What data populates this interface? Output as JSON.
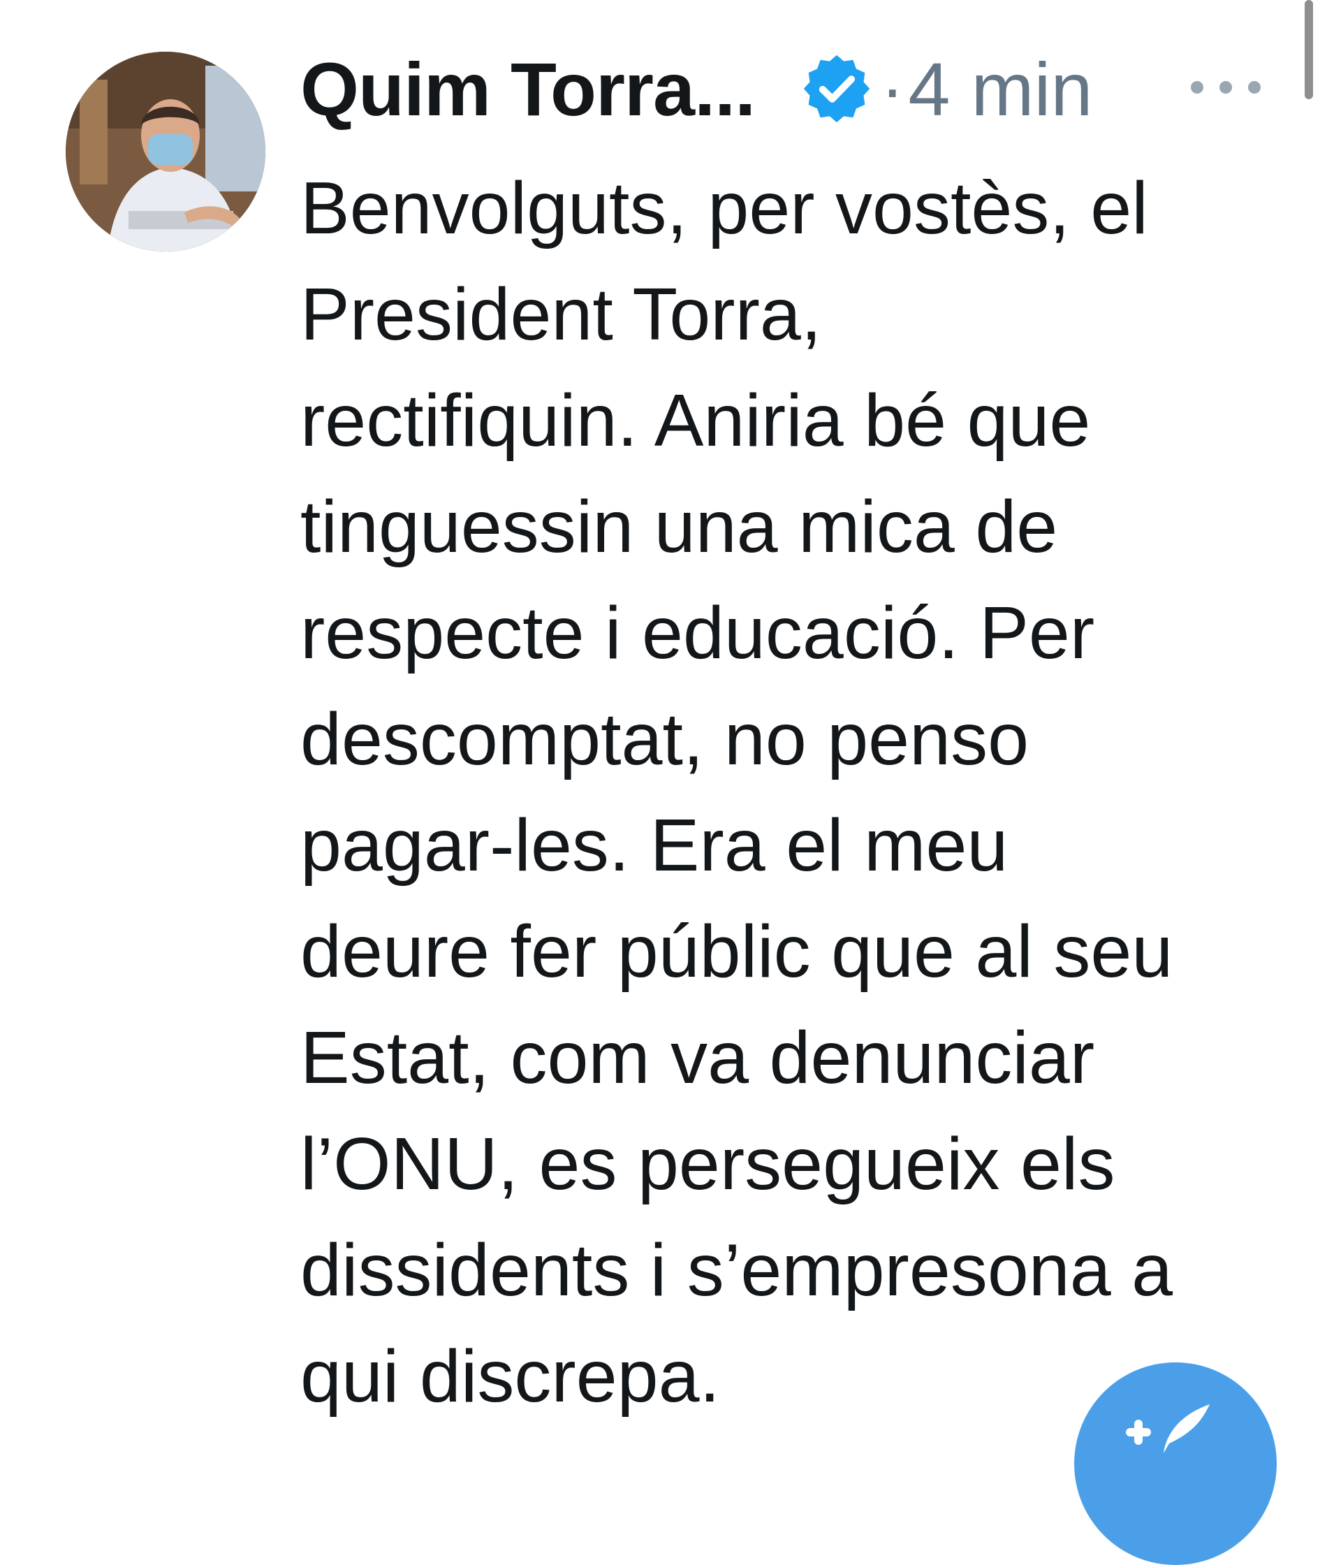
{
  "tweet": {
    "author_name": "Quim Torra...",
    "separator": "·",
    "timestamp": "4 min",
    "verified": true,
    "text_lines": [
      "Benvolguts, per vostès, el",
      "President Torra,",
      "rectifiquin. Aniria bé que",
      "tinguessin una mica de",
      "respecte i educació. Per",
      "descomptat, no penso",
      "pagar-les. Era el meu",
      "deure fer públic que al seu",
      "Estat, com va denunciar",
      "l’ONU, es persegueix els",
      "dissidents i s’empresona a",
      "qui discrepa."
    ]
  },
  "icons": {
    "avatar": "profile-photo",
    "verified": "verified-badge-icon",
    "more": "more-options-icon",
    "compose": "compose-tweet-icon"
  },
  "colors": {
    "verified_blue": "#1da1f2",
    "fab_blue": "#4a9fe8",
    "secondary_text": "#657786",
    "primary_text": "#14171a"
  }
}
